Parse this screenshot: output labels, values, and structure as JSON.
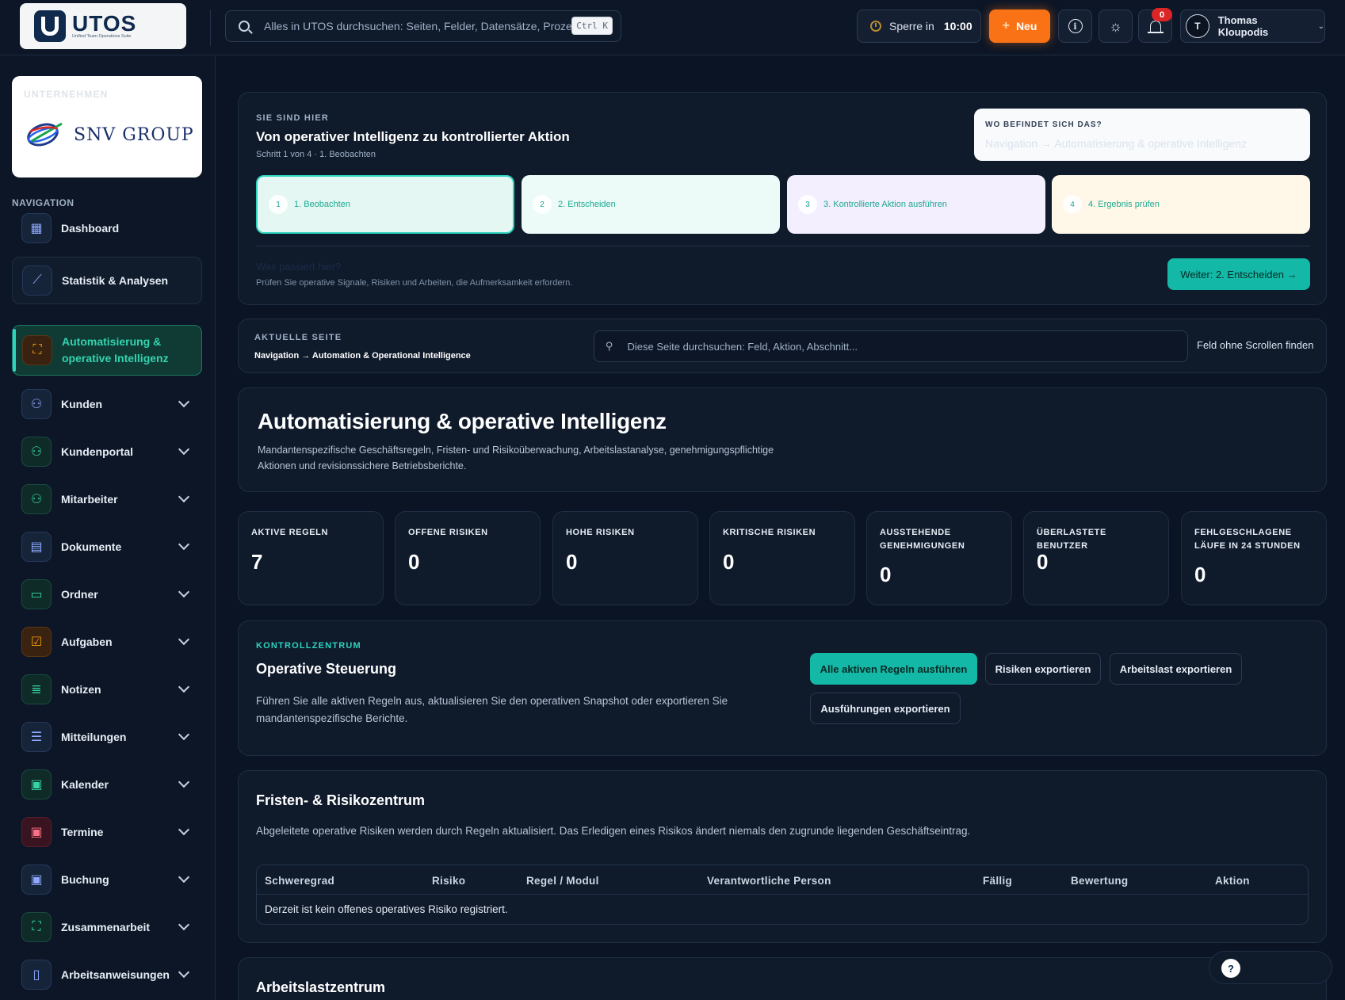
{
  "app": {
    "logo_text": "UTOS",
    "logo_subtitle": "Unified Team Operations Suite",
    "search_placeholder": "Alles in UTOS durchsuchen: Seiten, Felder, Datensätze, Prozesse",
    "shortcut": "Ctrl K",
    "lock_label": "Sperre in",
    "lock_time": "10:00",
    "new_label": "Neu",
    "notification_count": "0",
    "user_initial": "T",
    "user_name": "Thomas Kloupodis"
  },
  "sidebar": {
    "company_caption": "UNTERNEHMEN",
    "company_name": "SNV GROUP",
    "nav_caption": "NAVIGATION",
    "items": [
      {
        "label": "Dashboard",
        "icon": "grid-icon"
      },
      {
        "label": "Statistik & Analysen",
        "icon": "chart-line-icon"
      },
      {
        "label": "Automatisierung & operative Intelligenz",
        "icon": "workflow-icon",
        "active": true
      },
      {
        "label": "Kunden",
        "icon": "users-icon"
      },
      {
        "label": "Kundenportal",
        "icon": "users-icon"
      },
      {
        "label": "Mitarbeiter",
        "icon": "users-icon"
      },
      {
        "label": "Dokumente",
        "icon": "document-icon"
      },
      {
        "label": "Ordner",
        "icon": "folder-icon"
      },
      {
        "label": "Aufgaben",
        "icon": "checkbox-icon"
      },
      {
        "label": "Notizen",
        "icon": "note-icon"
      },
      {
        "label": "Mitteilungen",
        "icon": "message-icon"
      },
      {
        "label": "Kalender",
        "icon": "calendar-icon"
      },
      {
        "label": "Termine",
        "icon": "calendar-icon"
      },
      {
        "label": "Buchung",
        "icon": "calendar-icon"
      },
      {
        "label": "Zusammenarbeit",
        "icon": "workflow-icon"
      },
      {
        "label": "Arbeitsanweisungen",
        "icon": "book-icon"
      }
    ]
  },
  "guide": {
    "eyebrow": "SIE SIND HIER",
    "title": "Von operativer Intelligenz zu kontrollierter Aktion",
    "subtitle": "Schritt 1 von 4 · 1. Beobachten",
    "where_caption": "WO BEFINDET SICH DAS?",
    "where_path": "Navigation → Automatisierung & operative Intelligenz",
    "steps": [
      {
        "num": "1",
        "label": "1. Beobachten"
      },
      {
        "num": "2",
        "label": "2. Entscheiden"
      },
      {
        "num": "3",
        "label": "3. Kontrollierte Aktion ausführen"
      },
      {
        "num": "4",
        "label": "4. Ergebnis prüfen"
      }
    ],
    "hint_title": "Was passiert hier?",
    "hint_text": "Prüfen Sie operative Signale, Risiken und Arbeiten, die Aufmerksamkeit erfordern.",
    "next_label": "Weiter: 2. Entscheiden →"
  },
  "current_page": {
    "eyebrow": "AKTUELLE SEITE",
    "breadcrumb": "Navigation → Automation & Operational Intelligence",
    "search_placeholder": "Diese Seite durchsuchen: Feld, Aktion, Abschnitt...",
    "find_label": "Feld ohne Scrollen finden"
  },
  "hero": {
    "title": "Automatisierung & operative Intelligenz",
    "description": "Mandantenspezifische Geschäftsregeln, Fristen- und Risikoüberwachung, Arbeitslastanalyse, genehmigungspflichtige Aktionen und revisionssichere Betriebsberichte."
  },
  "stats": [
    {
      "label": "AKTIVE REGELN",
      "value": "7"
    },
    {
      "label": "OFFENE RISIKEN",
      "value": "0"
    },
    {
      "label": "HOHE RISIKEN",
      "value": "0"
    },
    {
      "label": "KRITISCHE RISIKEN",
      "value": "0"
    },
    {
      "label": "AUSSTEHENDE GENEHMIGUNGEN",
      "value": "0"
    },
    {
      "label": "ÜBERLASTETE BENUTZER",
      "value": "0"
    },
    {
      "label": "FEHLGESCHLAGENE LÄUFE IN 24 STUNDEN",
      "value": "0"
    }
  ],
  "control": {
    "eyebrow": "KONTROLLZENTRUM",
    "title": "Operative Steuerung",
    "description": "Führen Sie alle aktiven Regeln aus, aktualisieren Sie den operativen Snapshot oder exportieren Sie mandantenspezifische Berichte.",
    "run_all": "Alle aktiven Regeln ausführen",
    "export_risks": "Risiken exportieren",
    "export_workload": "Arbeitslast exportieren",
    "export_runs": "Ausführungen exportieren"
  },
  "risk": {
    "title": "Fristen- & Risikozentrum",
    "description": "Abgeleitete operative Risiken werden durch Regeln aktualisiert. Das Erledigen eines Risikos ändert niemals den zugrunde liegenden Geschäftseintrag.",
    "columns": [
      "Schweregrad",
      "Risiko",
      "Regel / Modul",
      "Verantwortliche Person",
      "Fällig",
      "Bewertung",
      "Aktion"
    ],
    "empty": "Derzeit ist kein offenes operatives Risiko registriert."
  },
  "workload": {
    "title": "Arbeitslastzentrum"
  },
  "help": {
    "icon_label": "?"
  }
}
